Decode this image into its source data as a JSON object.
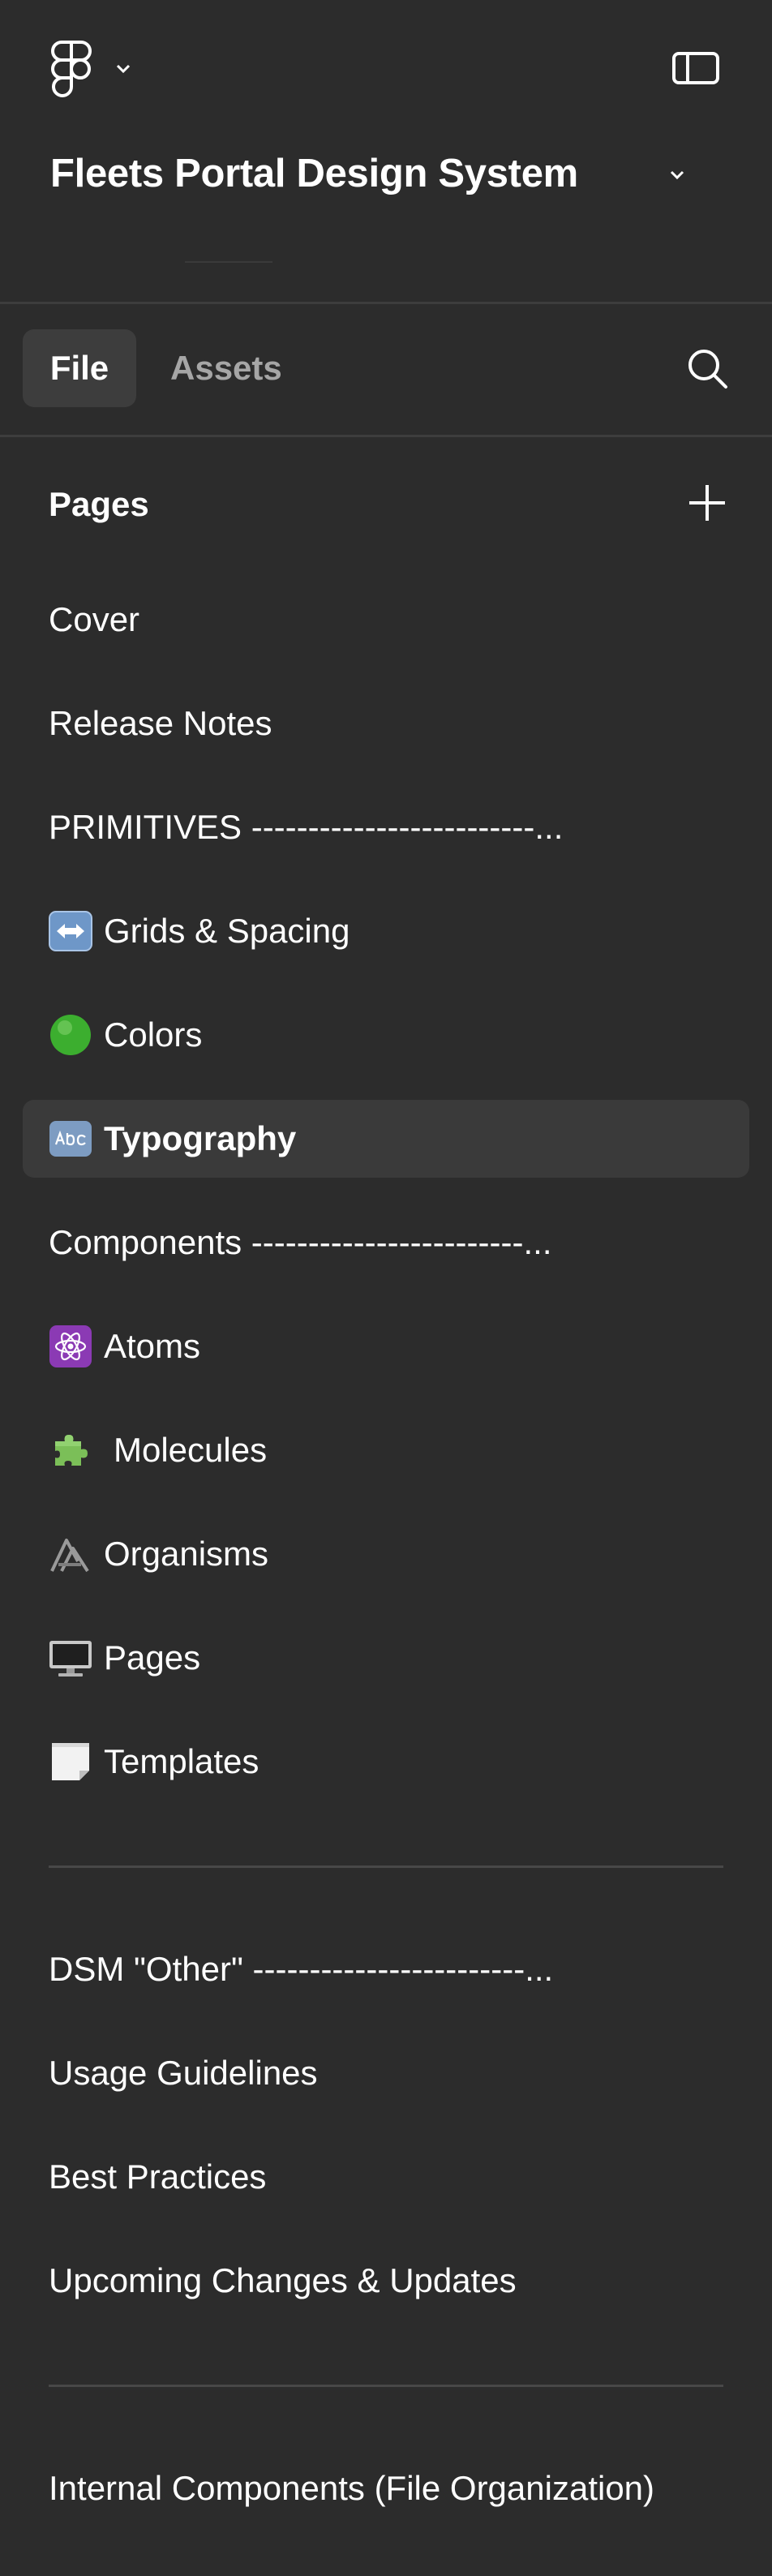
{
  "header": {
    "file_title": "Fleets Portal Design System"
  },
  "tabs": {
    "file_label": "File",
    "assets_label": "Assets"
  },
  "pages": {
    "header_label": "Pages",
    "items": [
      {
        "label": "Cover",
        "icon": ""
      },
      {
        "label": "Release Notes",
        "icon": ""
      },
      {
        "label": "PRIMITIVES -------------------------...",
        "icon": ""
      },
      {
        "label": "Grids & Spacing",
        "icon": "left-right-arrow-icon"
      },
      {
        "label": "Colors",
        "icon": "green-circle-icon"
      },
      {
        "label": "Typography",
        "icon": "abc-icon",
        "selected": true
      },
      {
        "label": "Components ------------------------...",
        "icon": ""
      },
      {
        "label": "Atoms",
        "icon": "atom-icon"
      },
      {
        "label": "Molecules",
        "icon": "puzzle-piece-icon"
      },
      {
        "label": "Organisms",
        "icon": "organisms-icon"
      },
      {
        "label": "Pages",
        "icon": "desktop-computer-icon"
      },
      {
        "label": "Templates",
        "icon": "notepad-icon"
      },
      {
        "label": "DSM \"Other\" ------------------------...",
        "icon": ""
      },
      {
        "label": "Usage Guidelines",
        "icon": ""
      },
      {
        "label": "Best Practices",
        "icon": ""
      },
      {
        "label": "Upcoming Changes & Updates",
        "icon": ""
      },
      {
        "label": "Internal Components (File Organization)",
        "icon": ""
      }
    ]
  },
  "colors": {
    "background": "#2c2c2c",
    "selected_row": "#3a3a3a",
    "tab_active": "#3d3d3d",
    "text_primary": "#ffffff",
    "text_muted": "#a6a6a6"
  }
}
